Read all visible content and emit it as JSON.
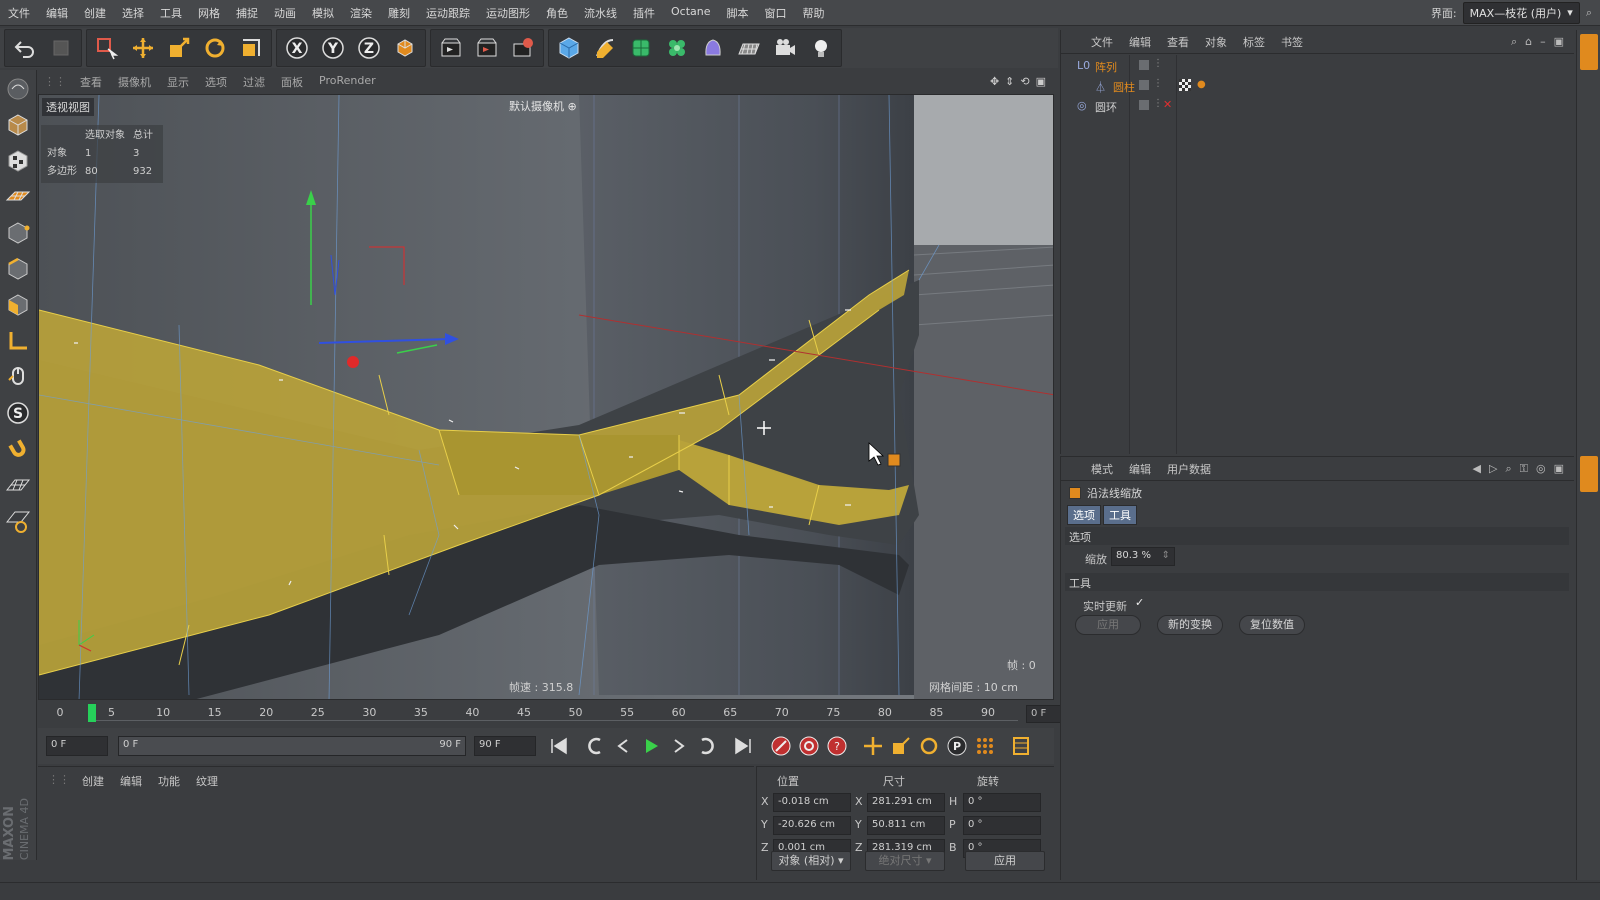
{
  "menubar": {
    "items": [
      "文件",
      "编辑",
      "创建",
      "选择",
      "工具",
      "网格",
      "捕捉",
      "动画",
      "模拟",
      "渲染",
      "雕刻",
      "运动跟踪",
      "运动图形",
      "角色",
      "流水线",
      "插件",
      "Octane",
      "脚本",
      "窗口",
      "帮助"
    ],
    "layout_label": "界面:",
    "layout_value": "MAX—枝花 (用户)"
  },
  "toolbar": {
    "icons": [
      "undo-icon",
      "redo-icon",
      "live-select-icon",
      "move-icon",
      "scale-icon",
      "rotate-icon",
      "last-tool-icon",
      "x-axis-icon",
      "y-axis-icon",
      "z-axis-icon",
      "coordinate-system-icon",
      "render-view-icon",
      "render-picture-viewer-icon",
      "render-settings-icon",
      "cube-icon",
      "pen-icon",
      "subdivision-icon",
      "cloner-icon",
      "deformer-icon",
      "floor-icon",
      "camera-icon",
      "light-icon"
    ]
  },
  "left_tools": [
    "model-mode-icon",
    "texture-mode-icon",
    "workplane-icon",
    "point-mode-icon",
    "edge-mode-icon",
    "polygon-mode-icon",
    "axis-mode-icon",
    "tweak-mode-icon",
    "snap-icon",
    "magnet-icon",
    "grid-snap-icon",
    "workplane-snap-icon"
  ],
  "viewport": {
    "menu": [
      "查看",
      "摄像机",
      "显示",
      "选项",
      "过滤",
      "面板",
      "ProRender"
    ],
    "view_label": "透视视图",
    "camera_label": "默认摄像机",
    "stats": {
      "header_selected": "选取对象",
      "header_total": "总计",
      "rows": [
        {
          "label": "对象",
          "selected": "1",
          "total": "3"
        },
        {
          "label": "多边形",
          "selected": "80",
          "total": "932"
        }
      ]
    },
    "speed": "帧速 : 315.8",
    "grid_spacing": "网格间距 : 10 cm",
    "frame": "帧 : 0"
  },
  "timeline": {
    "ticks": [
      "0",
      "5",
      "10",
      "15",
      "20",
      "25",
      "30",
      "35",
      "40",
      "45",
      "50",
      "55",
      "60",
      "65",
      "70",
      "75",
      "80",
      "85",
      "90"
    ],
    "current_frame": "0 F"
  },
  "transport": {
    "start_field": "0 F",
    "range_start": "0 F",
    "range_end": "90 F",
    "end_field": "90 F"
  },
  "material_manager": {
    "menu": [
      "创建",
      "编辑",
      "功能",
      "纹理"
    ]
  },
  "coordinates": {
    "headers": {
      "position": "位置",
      "size": "尺寸",
      "rotation": "旋转"
    },
    "rows": [
      {
        "axis": "X",
        "position": "-0.018 cm",
        "size_axis": "X",
        "size": "281.291 cm",
        "rot_axis": "H",
        "rotation": "0 °"
      },
      {
        "axis": "Y",
        "position": "-20.626 cm",
        "size_axis": "Y",
        "size": "50.811 cm",
        "rot_axis": "P",
        "rotation": "0 °"
      },
      {
        "axis": "Z",
        "position": "0.001 cm",
        "size_axis": "Z",
        "size": "281.319 cm",
        "rot_axis": "B",
        "rotation": "0 °"
      }
    ],
    "mode_select": "对象 (相对)",
    "size_select": "绝对尺寸",
    "apply": "应用"
  },
  "object_manager": {
    "menu": [
      "文件",
      "编辑",
      "查看",
      "对象",
      "标签",
      "书签"
    ],
    "objects": [
      {
        "name": "阵列",
        "indent": 0,
        "color": "#e08a1e"
      },
      {
        "name": "圆柱",
        "indent": 1,
        "color": "#e08a1e"
      },
      {
        "name": "圆环",
        "indent": 0,
        "color": "#cfcfcf"
      }
    ]
  },
  "attribute_manager": {
    "menu": [
      "模式",
      "编辑",
      "用户数据"
    ],
    "tool_name": "沿法线缩放",
    "tabs": [
      "选项",
      "工具"
    ],
    "section_options": "选项",
    "scale_label": "缩放",
    "scale_value": "80.3 %",
    "section_tool": "工具",
    "realtime_label": "实时更新",
    "realtime_check": "✓",
    "buttons": [
      "应用",
      "新的变换",
      "复位数值"
    ]
  },
  "branding": {
    "maxon": "MAXON",
    "product": "CINEMA 4D"
  },
  "colors": {
    "accent": "#e8a21e",
    "selection": "#b7a438",
    "playhead": "#26d05a"
  }
}
